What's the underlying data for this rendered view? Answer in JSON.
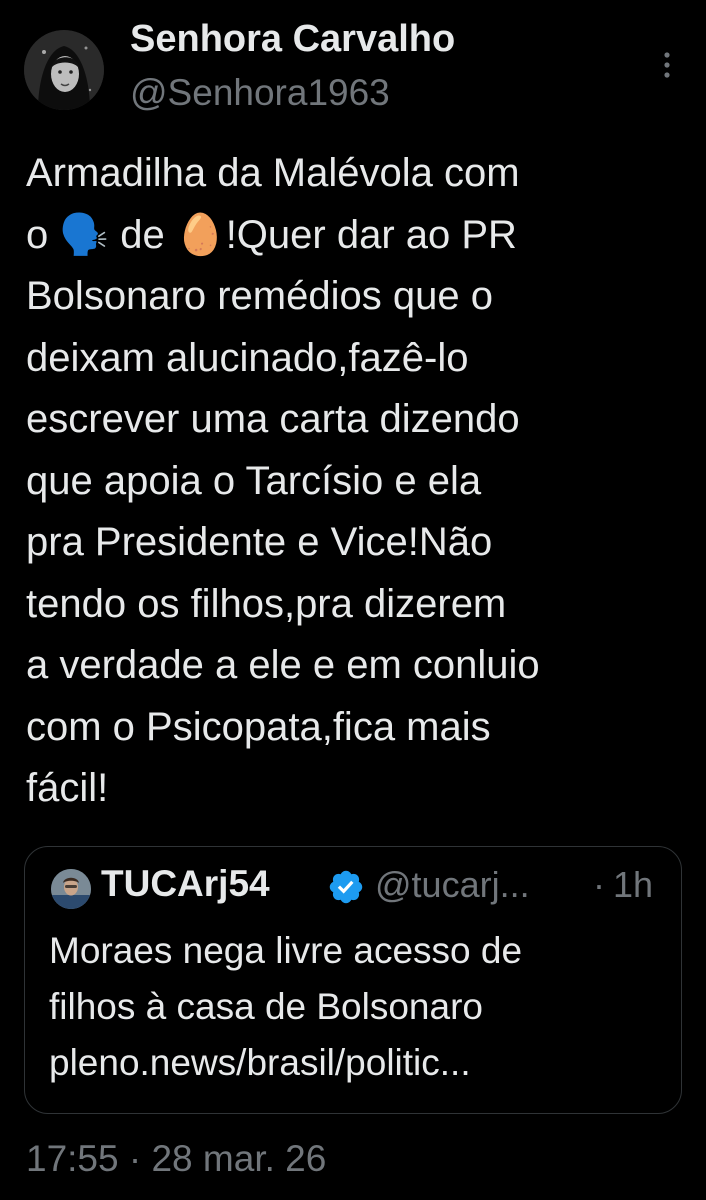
{
  "tweet": {
    "display_name": "Senhora Carvalho",
    "handle": "@Senhora1963",
    "text": "Armadilha da Malévola com\no 🗣️ de 🥚!Quer dar ao PR\nBolsonaro remédios que o\ndeixam alucinado,fazê-lo\nescrever uma carta dizendo\nque apoia o Tarcísio e ela\npra Presidente e Vice!Não\ntendo os filhos,pra dizerem\na verdade a ele e em conluio\ncom o Psicopata,fica mais\nfácil!",
    "time": "17:55",
    "separator": " · ",
    "date": "28 mar. 26"
  },
  "quote": {
    "display_name": "TUCArj54",
    "handle": "@tucarj...",
    "separator": "·",
    "time_ago": "1h",
    "text": "Moraes nega livre acesso de\nfilhos à casa de Bolsonaro\npleno.news/brasil/politic..."
  },
  "colors": {
    "background": "#000000",
    "text_primary": "#e7e9ea",
    "text_secondary": "#71767b",
    "border": "#2f3336",
    "verified": "#1d9bf0"
  },
  "icons": {
    "more": "more-vertical-icon",
    "verified": "verified-badge-icon"
  }
}
